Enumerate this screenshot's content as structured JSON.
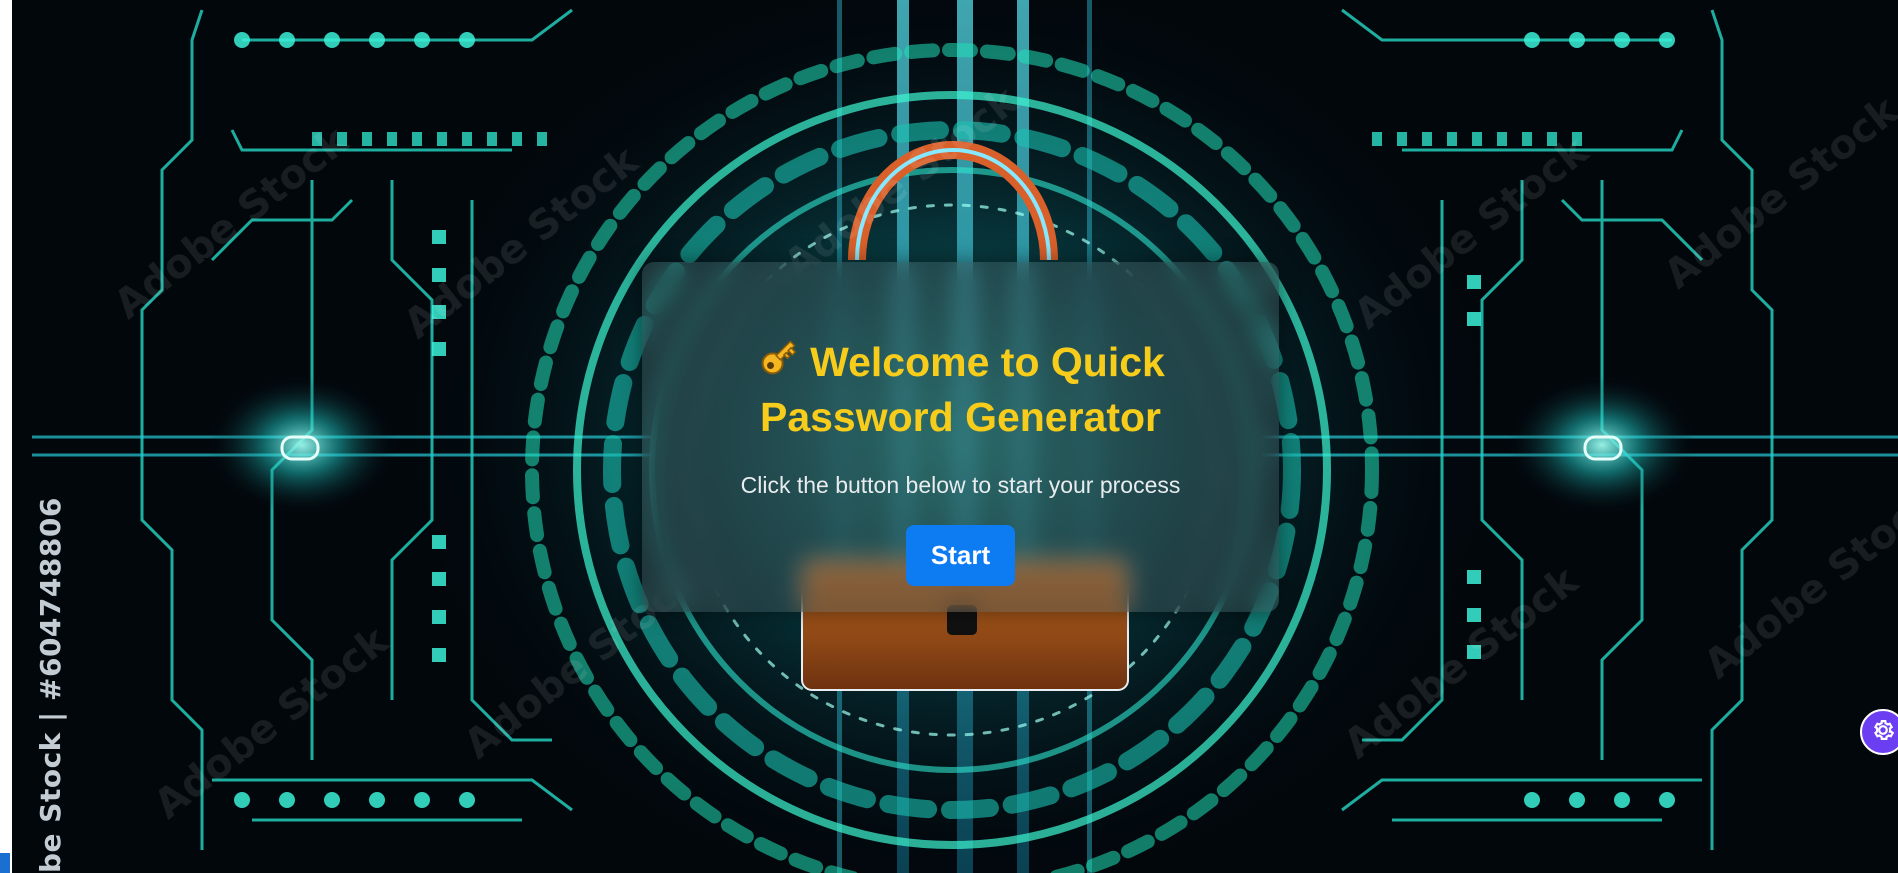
{
  "card": {
    "icon": "key-icon",
    "title": "Welcome to Quick Password Generator",
    "subtitle": "Click the button below to start your process",
    "start_label": "Start"
  },
  "background": {
    "credit_text": "be Stock | #604748806",
    "watermark_text": "Adobe Stock"
  },
  "settings_widget": {
    "icon": "gear-icon"
  },
  "colors": {
    "title": "#f7cc1b",
    "button": "#0d7bf1",
    "circuit_glow": "#2fe8c8",
    "settings_widget": "#6c3ef2"
  }
}
